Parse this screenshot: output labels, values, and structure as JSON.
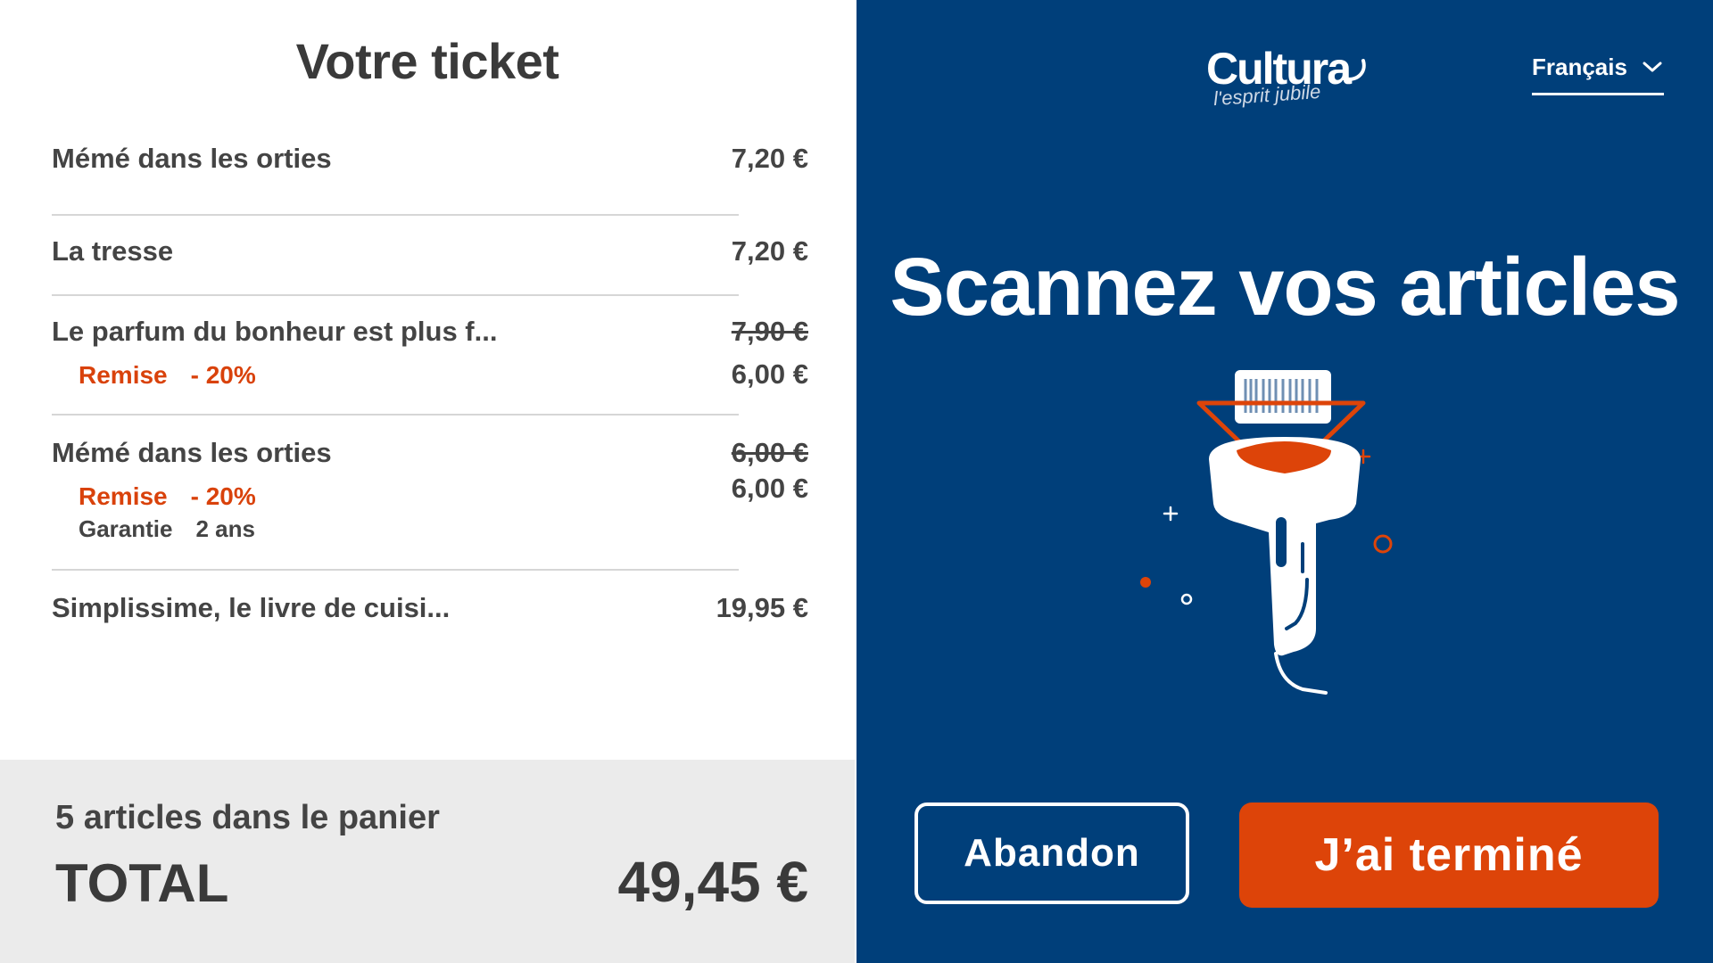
{
  "ticket": {
    "title": "Votre ticket",
    "items": [
      {
        "name": "Mémé dans les orties",
        "price": "7,20 €"
      },
      {
        "name": "La tresse",
        "price": "7,20 €"
      },
      {
        "name": "Le parfum du bonheur est plus f...",
        "original_price": "7,90 €",
        "discount_label": "Remise",
        "discount_value": "- 20%",
        "price": "6,00 €"
      },
      {
        "name": "Mémé dans les orties",
        "original_price": "6,00 €",
        "discount_label": "Remise",
        "discount_value": "- 20%",
        "price": "6,00 €",
        "warranty_label": "Garantie",
        "warranty_value": "2 ans"
      },
      {
        "name": "Simplissime, le livre de cuisi...",
        "price": "19,95 €"
      }
    ]
  },
  "footer": {
    "count_text": "5 articles dans le panier",
    "total_label": "TOTAL",
    "total_value": "49,45 €"
  },
  "header": {
    "logo_text": "Cultura",
    "logo_tagline": "l'esprit jubile",
    "language": "Français"
  },
  "main": {
    "heading": "Scannez vos articles"
  },
  "actions": {
    "abandon_label": "Abandon",
    "done_label": "J’ai terminé"
  },
  "colors": {
    "brand_blue": "#003f7a",
    "accent_orange": "#dd4409",
    "text_dark": "#444444"
  },
  "icons": [
    "chevron-down-icon",
    "barcode-scanner-icon"
  ]
}
